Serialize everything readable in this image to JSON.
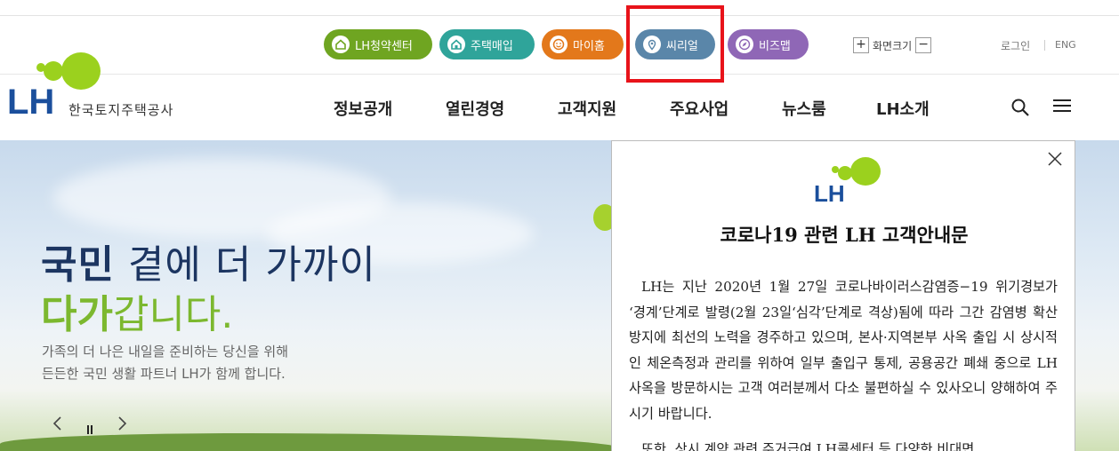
{
  "util": {
    "buttons": [
      {
        "label": "LH청약센터",
        "icon": "house-icon",
        "color": "#6fa521"
      },
      {
        "label": "주택매입",
        "icon": "house-outline-icon",
        "color": "#2fa49a"
      },
      {
        "label": "마이홈",
        "icon": "smile-icon",
        "color": "#e3781b"
      },
      {
        "label": "씨리얼",
        "icon": "location-pin-icon",
        "color": "#5a86a9"
      },
      {
        "label": "비즈맵",
        "icon": "compass-icon",
        "color": "#8f67b6"
      }
    ],
    "font_size": {
      "plus": "+",
      "label": "화면크기",
      "minus": "−"
    },
    "login": "로그인",
    "eng": "ENG"
  },
  "logo": {
    "text": "한국토지주택공사",
    "brand_color": "#1b4f9c",
    "accent_color": "#9bd11e"
  },
  "gnb": [
    "정보공개",
    "열린경영",
    "고객지원",
    "주요사업",
    "뉴스룸",
    "LH소개"
  ],
  "hero": {
    "line1_bold": "국민",
    "line1_light": " 곁에 더 가까이",
    "line2_bold": "다가",
    "line2_light": "갑니다.",
    "desc1": "가족의 더 나은 내일을 준비하는 당신을 위해",
    "desc2": "든든한 국민 생활 파트너 LH가 함께 합니다."
  },
  "popup": {
    "title": "코로나19 관련 LH 고객안내문",
    "paragraph1": "LH는 지난 2020년 1월 27일 코로나바이러스감염증−19 위기경보가 ‘경계’단계로 발령(2월 23일‘심각’단계로 격상)됨에 따라 그간 감염병 확산 방지에 최선의 노력을 경주하고 있으며, 본사·지역본부 사옥 출입 시 상시적인 체온측정과 관리를 위하여 일부 출입구 통제, 공용공간 폐쇄 중으로 LH 사옥을 방문하시는 고객 여러분께서 다소 불편하실 수 있사오니 양해하여 주시기 바랍니다.",
    "paragraph2": "또한, 상시 계약 관련 주거급여 LH콜센터 등 다양한 비대면"
  }
}
